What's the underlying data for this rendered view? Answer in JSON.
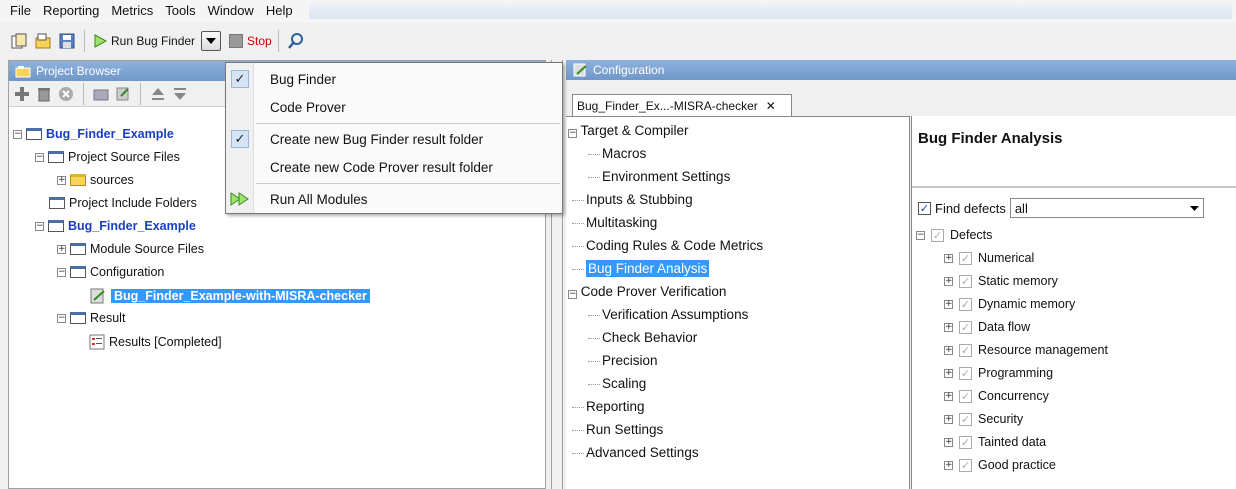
{
  "menubar": {
    "items": [
      "File",
      "Reporting",
      "Metrics",
      "Tools",
      "Window",
      "Help"
    ]
  },
  "toolbar": {
    "run_label": "Run Bug Finder",
    "stop_label": "Stop"
  },
  "project_browser": {
    "title": "Project Browser",
    "tree": {
      "root": "Bug_Finder_Example",
      "source_files": "Project Source Files",
      "sources": "sources",
      "include_folders": "Project Include Folders",
      "module": "Bug_Finder_Example",
      "module_source": "Module Source Files",
      "configuration": "Configuration",
      "config_file": "Bug_Finder_Example-with-MISRA-checker",
      "result": "Result",
      "results": "Results [Completed]"
    }
  },
  "dropdown": {
    "items": [
      {
        "label": "Bug Finder",
        "checked": true
      },
      {
        "label": "Code Prover",
        "checked": false
      },
      {
        "label": "Create new Bug Finder result folder",
        "checked": true
      },
      {
        "label": "Create new Code Prover result folder",
        "checked": false
      },
      {
        "label": "Run All Modules",
        "icon": "run-all-icon"
      }
    ]
  },
  "configuration": {
    "title": "Configuration",
    "tab_label": "Bug_Finder_Ex...-MISRA-checker",
    "tree": [
      "Target & Compiler",
      "Macros",
      "Environment Settings",
      "Inputs & Stubbing",
      "Multitasking",
      "Coding Rules & Code Metrics",
      "Bug Finder Analysis",
      "Code Prover Verification",
      "Verification Assumptions",
      "Check Behavior",
      "Precision",
      "Scaling",
      "Reporting",
      "Run Settings",
      "Advanced Settings"
    ],
    "panel": {
      "title": "Bug Finder Analysis",
      "find_defects_label": "Find defects",
      "find_defects_value": "all",
      "defects_root": "Defects",
      "defects": [
        "Numerical",
        "Static memory",
        "Dynamic memory",
        "Data flow",
        "Resource management",
        "Programming",
        "Concurrency",
        "Security",
        "Tainted data",
        "Good practice"
      ]
    }
  },
  "colors": {
    "selection": "#3399ff",
    "title_bar": "#7aa0d0",
    "link_blue": "#1a3fc2"
  }
}
